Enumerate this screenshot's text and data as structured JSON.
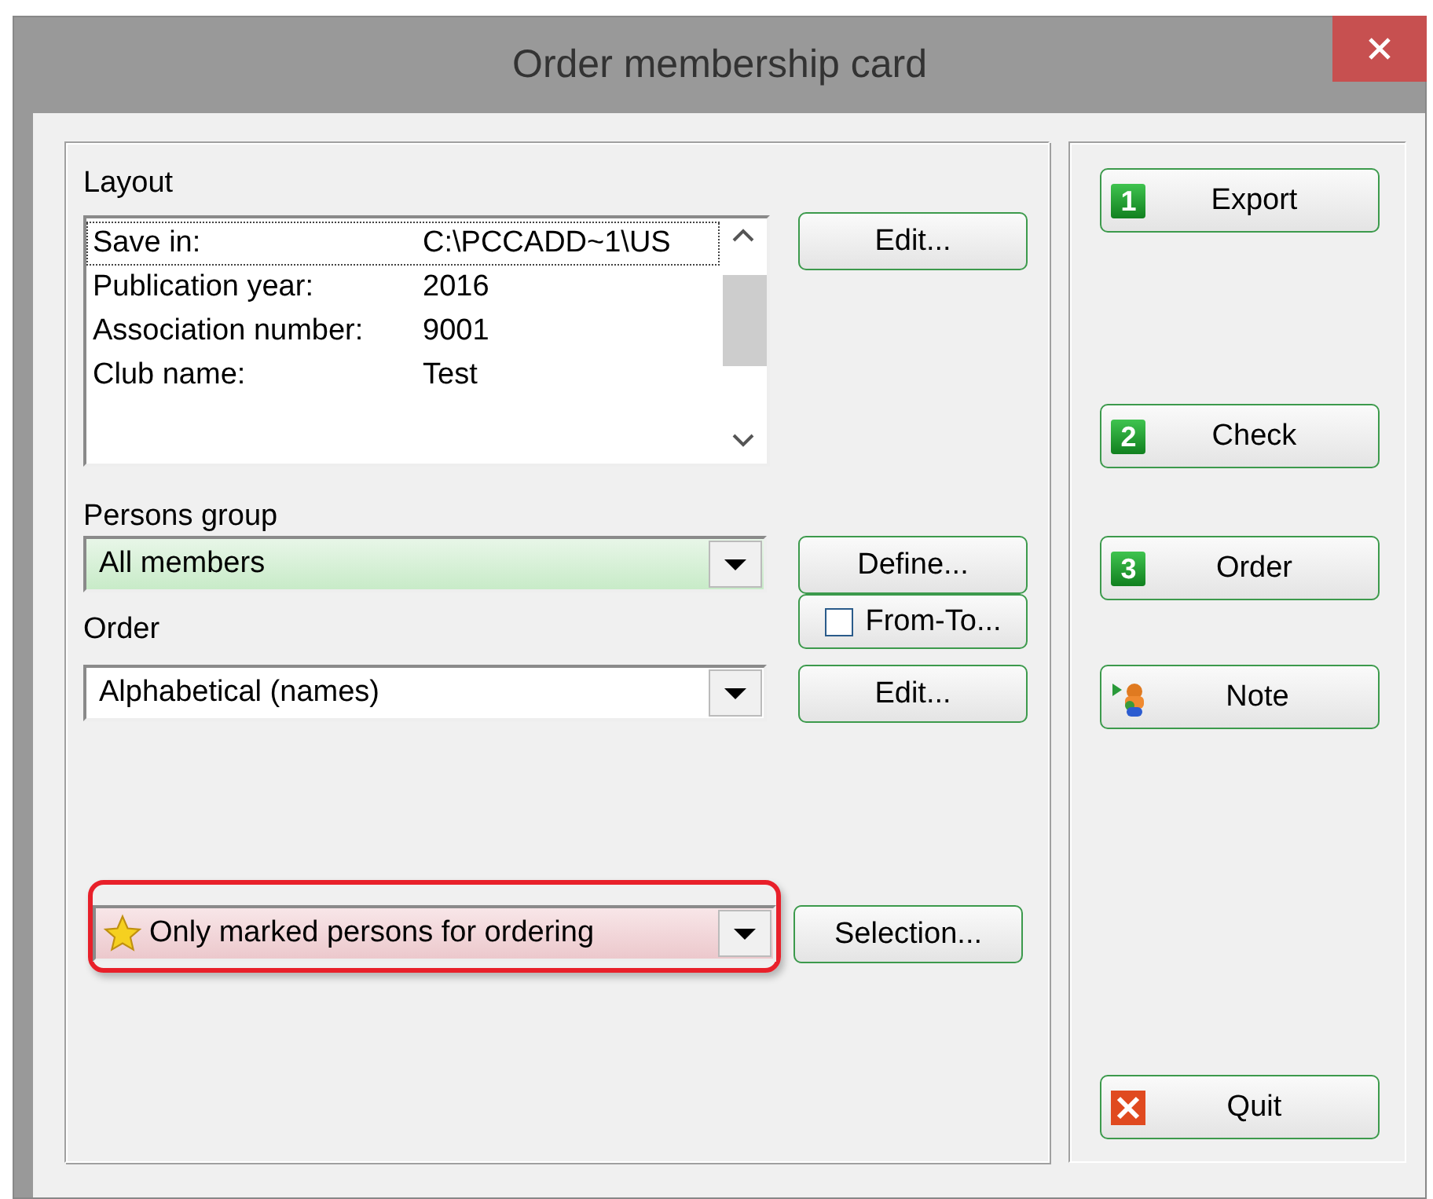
{
  "window": {
    "title": "Order membership card"
  },
  "layout": {
    "label": "Layout",
    "button": "Edit...",
    "rows": [
      {
        "name": "Save in:",
        "value": "C:\\PCCADD~1\\US",
        "selected": true
      },
      {
        "name": "Publication year:",
        "value": "2016",
        "selected": false
      },
      {
        "name": "Association number:",
        "value": "9001",
        "selected": false
      },
      {
        "name": "Club name:",
        "value": "Test",
        "selected": false
      }
    ]
  },
  "persons_group": {
    "label": "Persons group",
    "value": "All members",
    "button": "Define...",
    "from_to": {
      "label": "From-To...",
      "checked": false
    }
  },
  "order": {
    "label": "Order",
    "value": "Alphabetical (names)",
    "button": "Edit..."
  },
  "selection": {
    "value": "Only marked persons for ordering",
    "button": "Selection..."
  },
  "actions": [
    {
      "kind": "number",
      "badge": "1",
      "label": "Export"
    },
    {
      "kind": "number",
      "badge": "2",
      "label": "Check"
    },
    {
      "kind": "number",
      "badge": "3",
      "label": "Order"
    },
    {
      "kind": "note",
      "label": "Note"
    },
    {
      "kind": "quit",
      "label": "Quit"
    }
  ]
}
